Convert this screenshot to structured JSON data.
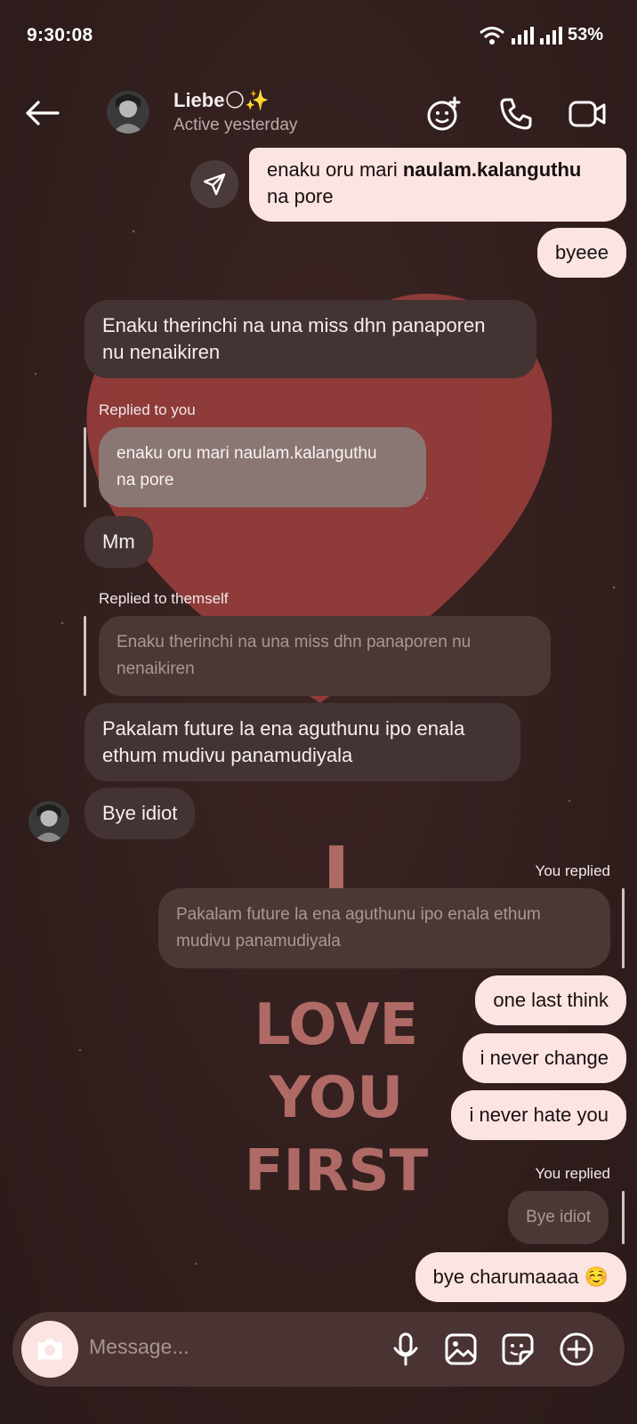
{
  "status_bar": {
    "time": "9:30:08",
    "battery": "53%"
  },
  "header": {
    "contact_name": "Liebe🌕✨",
    "presence": "Active yesterday"
  },
  "wallpaper": {
    "text_lines": [
      "I",
      "LOVE",
      "YOU",
      "FIRST"
    ]
  },
  "messages": {
    "m1": {
      "line1_pre": "enaku oru mari ",
      "line1_bold": "naulam.kalanguthu",
      "line2": "na pore"
    },
    "m2": "byeee",
    "m3": {
      "line1": "Enaku therinchi na una miss dhn panaporen",
      "line2": "nu nenaikiren"
    },
    "m4": {
      "label": "Replied to you",
      "quote_line1": "enaku oru mari naulam.kalanguthu",
      "quote_line2": "na pore",
      "text": "Mm"
    },
    "m5": {
      "label": "Replied to themself",
      "quote_line1": "Enaku therinchi na una miss dhn panaporen nu",
      "quote_line2": "nenaikiren",
      "line1": "Pakalam future la ena aguthunu ipo enala",
      "line2": "ethum mudivu panamudiyala"
    },
    "m6": "Bye idiot",
    "m7": {
      "label": "You replied",
      "quote_line1": "Pakalam future la ena aguthunu ipo enala ethum",
      "quote_line2": "mudivu panamudiyala",
      "text": "one last think"
    },
    "m8": "i never change",
    "m9": "i never hate you",
    "m10": {
      "label": "You replied",
      "quote": "Bye idiot",
      "text": "bye charumaaaa ☺️"
    }
  },
  "composer": {
    "placeholder": "Message..."
  },
  "colors": {
    "background": "#33201f",
    "outgoing_bubble": "#fbe4e2",
    "incoming_bubble": "#433332",
    "heart": "#9b3f3c",
    "wallpaper_text": "#b06a66"
  }
}
